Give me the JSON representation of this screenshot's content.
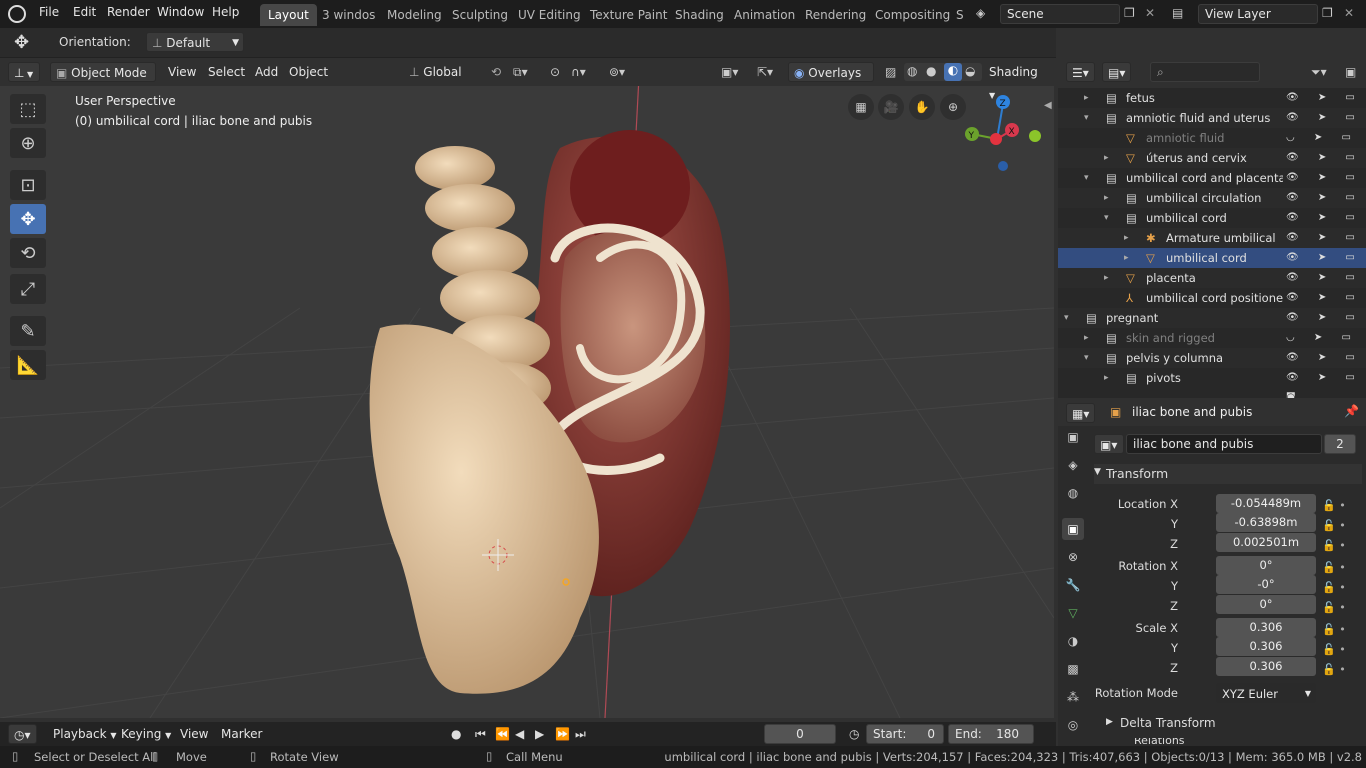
{
  "menu": [
    "File",
    "Edit",
    "Render",
    "Window",
    "Help"
  ],
  "workspaces": [
    "Layout",
    "3 windos",
    "Modeling",
    "Sculpting",
    "UV Editing",
    "Texture Paint",
    "Shading",
    "Animation",
    "Rendering",
    "Compositing",
    "S"
  ],
  "scene": "Scene",
  "view_layer": "View Layer",
  "tool_header": {
    "orientation_label": "Orientation:",
    "orientation_value": "Default"
  },
  "viewport_header": {
    "mode": "Object Mode",
    "menus": [
      "View",
      "Select",
      "Add",
      "Object"
    ],
    "transform_orientation": "Global",
    "overlays": "Overlays",
    "shading": "Shading"
  },
  "viewport": {
    "perspective": "User Perspective",
    "active_info": "(0) umbilical cord | iliac bone and pubis",
    "gizmo_axes": [
      "X",
      "Y",
      "Z"
    ]
  },
  "outliner": {
    "rows": [
      {
        "label": "fetus",
        "dim": false,
        "sel": false
      },
      {
        "label": "amniotic fluid and uterus",
        "dim": false,
        "sel": false
      },
      {
        "label": "amniotic fluid",
        "dim": true,
        "sel": false
      },
      {
        "label": "úterus and cervix",
        "dim": false,
        "sel": false
      },
      {
        "label": "umbilical cord and placenta",
        "dim": false,
        "sel": false
      },
      {
        "label": "umbilical circulation",
        "dim": false,
        "sel": false
      },
      {
        "label": "umbilical cord",
        "dim": false,
        "sel": false
      },
      {
        "label": "Armature umbilical",
        "dim": false,
        "sel": false
      },
      {
        "label": "umbilical cord",
        "dim": false,
        "sel": true
      },
      {
        "label": "placenta",
        "dim": false,
        "sel": false
      },
      {
        "label": "umbilical cord positioner",
        "dim": false,
        "sel": false
      },
      {
        "label": "pregnant",
        "dim": false,
        "sel": false
      },
      {
        "label": "skin and rigged",
        "dim": true,
        "sel": false
      },
      {
        "label": "pelvis y columna",
        "dim": false,
        "sel": false
      },
      {
        "label": "pivots",
        "dim": false,
        "sel": false
      }
    ]
  },
  "properties": {
    "object_name": "iliac bone and pubis",
    "data_name": "iliac bone and pubis",
    "users": "2",
    "panel_title": "Transform",
    "location_label": "Location X",
    "location": [
      "-0.054489m",
      "-0.63898m",
      "0.002501m"
    ],
    "rotation_label": "Rotation X",
    "rotation": [
      "0°",
      "-0°",
      "0°"
    ],
    "scale_label": "Scale X",
    "scale": [
      "0.306",
      "0.306",
      "0.306"
    ],
    "axis_y": "Y",
    "axis_z": "Z",
    "rotation_mode_label": "Rotation Mode",
    "rotation_mode": "XYZ Euler",
    "delta": "Delta Transform",
    "relations": "Relations"
  },
  "timeline": {
    "menus": [
      "Playback",
      "Keying",
      "View",
      "Marker"
    ],
    "current_frame": "0",
    "start_label": "Start:",
    "start": "0",
    "end_label": "End:",
    "end": "180"
  },
  "status": {
    "select": "Select or Deselect All",
    "move": "Move",
    "rotate": "Rotate View",
    "call_menu": "Call Menu",
    "stats": "umbilical cord | iliac bone and pubis | Verts:204,157 | Faces:204,323 | Tris:407,663 | Objects:0/13 | Mem: 365.0 MB | v2.8"
  },
  "colors": {
    "accent": "#4772b3",
    "selected_row": "#334d80",
    "bone": "#e7cba6",
    "uterus": "#7a2e2a"
  }
}
